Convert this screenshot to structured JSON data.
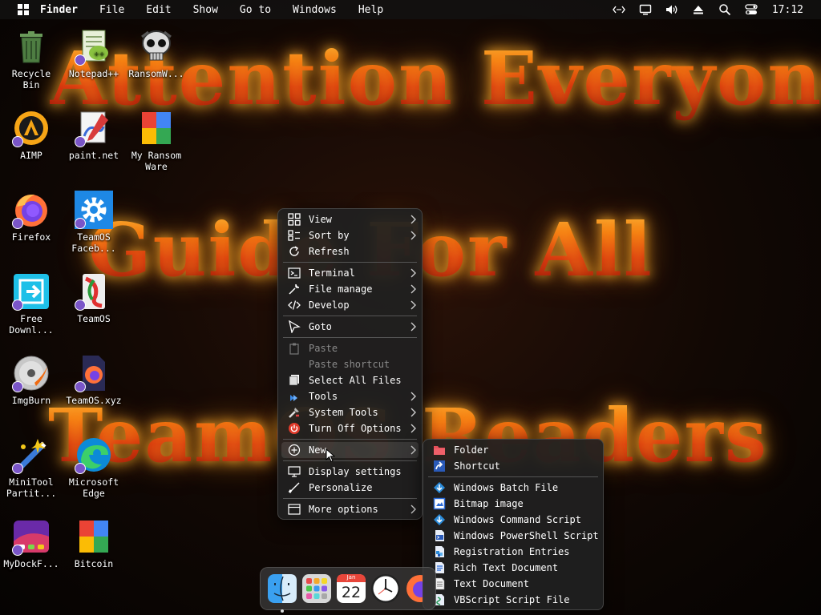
{
  "menubar": {
    "app": "Finder",
    "items": [
      "File",
      "Edit",
      "Show",
      "Go to",
      "Windows",
      "Help"
    ],
    "clock": "17:12",
    "tray_icons": [
      "network-icon",
      "display-icon",
      "volume-icon",
      "eject-icon",
      "search-icon",
      "control-center-icon"
    ]
  },
  "wallpaper": {
    "lines": [
      "Attention Everyone",
      "Guide For All",
      "TeamOS Readers"
    ]
  },
  "desktop": {
    "icons": [
      {
        "name": "recycle-bin",
        "label": "Recycle\nBin"
      },
      {
        "name": "notepad-plus-plus",
        "label": "Notepad++"
      },
      {
        "name": "ransomware",
        "label": "RansomW..."
      },
      {
        "name": "aimp",
        "label": "AIMP"
      },
      {
        "name": "paint-net",
        "label": "paint.net"
      },
      {
        "name": "my-ransomware",
        "label": "My Ransom\nWare"
      },
      {
        "name": "firefox",
        "label": "Firefox"
      },
      {
        "name": "teamos-facebook",
        "label": "TeamOS\nFaceb..."
      },
      {
        "name": "free-download-manager",
        "label": "Free\nDownl..."
      },
      {
        "name": "teamos",
        "label": "TeamOS"
      },
      {
        "name": "imgburn",
        "label": "ImgBurn"
      },
      {
        "name": "teamos-xyz",
        "label": "TeamOS.xyz"
      },
      {
        "name": "minitool-partition",
        "label": "MiniTool\nPartit..."
      },
      {
        "name": "microsoft-edge",
        "label": "Microsoft\nEdge"
      },
      {
        "name": "mydockfinder",
        "label": "MyDockF..."
      },
      {
        "name": "bitcoin",
        "label": "Bitcoin"
      }
    ]
  },
  "context_menu": {
    "groups": [
      [
        {
          "label": "View",
          "icon": "grid-icon",
          "submenu": true
        },
        {
          "label": "Sort by",
          "icon": "sort-icon",
          "submenu": true
        },
        {
          "label": "Refresh",
          "icon": "refresh-icon",
          "submenu": false
        }
      ],
      [
        {
          "label": "Terminal",
          "icon": "terminal-icon",
          "submenu": true
        },
        {
          "label": "File manage",
          "icon": "wrench-icon",
          "submenu": true
        },
        {
          "label": "Develop",
          "icon": "code-icon",
          "submenu": true
        }
      ],
      [
        {
          "label": "Goto",
          "icon": "pointer-icon",
          "submenu": true
        }
      ],
      [
        {
          "label": "Paste",
          "icon": "paste-icon",
          "submenu": false,
          "disabled": true
        },
        {
          "label": "Paste shortcut",
          "icon": "paste-shortcut-icon",
          "submenu": false,
          "disabled": true
        },
        {
          "label": "Select All Files",
          "icon": "select-all-icon",
          "submenu": false
        },
        {
          "label": "Tools",
          "icon": "tools-icon",
          "submenu": true
        },
        {
          "label": "System Tools",
          "icon": "system-tools-icon",
          "submenu": true
        },
        {
          "label": "Turn Off Options",
          "icon": "power-icon",
          "submenu": true
        }
      ],
      [
        {
          "label": "New",
          "icon": "plus-circle-icon",
          "submenu": true,
          "highlighted": true
        }
      ],
      [
        {
          "label": "Display settings",
          "icon": "display-settings-icon",
          "submenu": false
        },
        {
          "label": "Personalize",
          "icon": "brush-icon",
          "submenu": false
        }
      ],
      [
        {
          "label": "More options",
          "icon": "more-options-icon",
          "submenu": true
        }
      ]
    ]
  },
  "new_submenu": {
    "groups": [
      [
        {
          "label": "Folder",
          "icon": "folder-icon"
        },
        {
          "label": "Shortcut",
          "icon": "shortcut-icon"
        }
      ],
      [
        {
          "label": "Windows Batch File",
          "icon": "batch-file-icon"
        },
        {
          "label": "Bitmap image",
          "icon": "bitmap-icon"
        },
        {
          "label": "Windows Command Script",
          "icon": "cmd-script-icon"
        },
        {
          "label": "Windows PowerShell Script",
          "icon": "powershell-icon"
        },
        {
          "label": "Registration Entries",
          "icon": "registry-icon"
        },
        {
          "label": "Rich Text Document",
          "icon": "rtf-icon"
        },
        {
          "label": "Text Document",
          "icon": "text-doc-icon"
        },
        {
          "label": "VBScript Script File",
          "icon": "vbscript-icon"
        }
      ]
    ]
  },
  "dock": {
    "items": [
      "finder",
      "launchpad",
      "calendar",
      "clock",
      "firefox"
    ],
    "calendar": {
      "month": "Jan",
      "day": "22"
    }
  }
}
